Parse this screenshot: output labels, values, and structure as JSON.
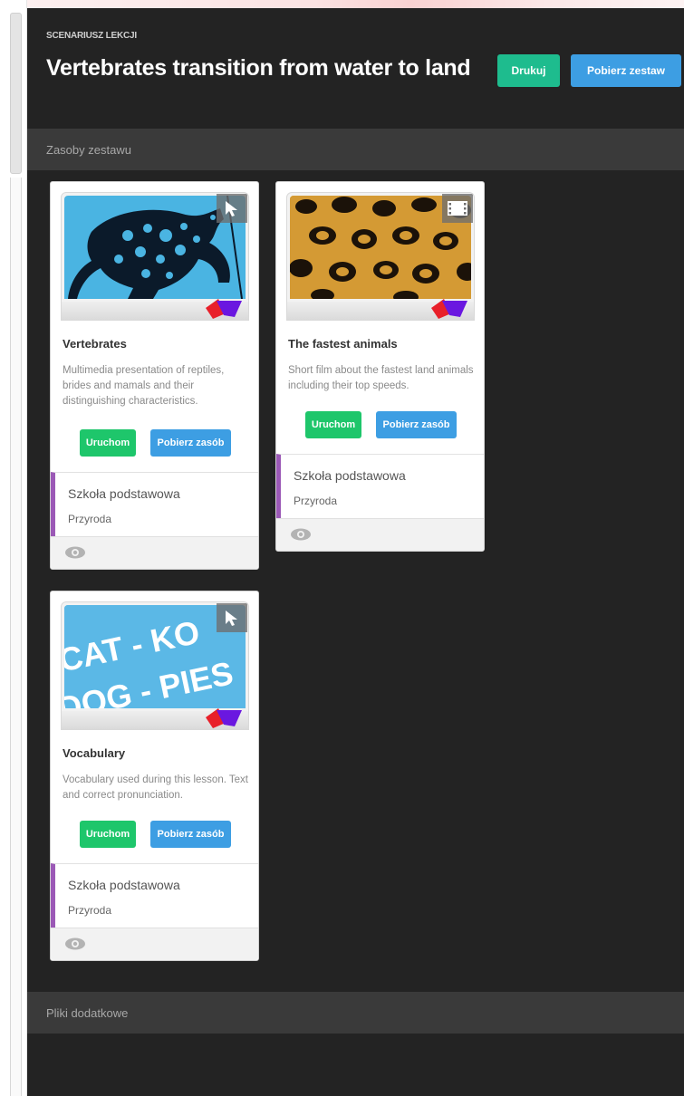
{
  "header": {
    "eyebrow": "SCENARIUSZ LEKCJI",
    "title": "Vertebrates transition from water to land",
    "print_label": "Drukuj",
    "download_set_label": "Pobierz zestaw"
  },
  "sections": {
    "resources": "Zasoby zestawu",
    "extra_files": "Pliki dodatkowe"
  },
  "cards": [
    {
      "title": "Vertebrates",
      "description": "Multimedia presentation of reptiles, brides and mamals and their distinguishing characteristics.",
      "run_label": "Uruchom",
      "download_label": "Pobierz zasób",
      "level": "Szkoła podstawowa",
      "subject": "Przyroda",
      "type_icon": "cursor-icon",
      "thumbnail": "frog-silhouette"
    },
    {
      "title": "The fastest animals",
      "description": "Short film about the fastest land animals including their top speeds.",
      "run_label": "Uruchom",
      "download_label": "Pobierz zasób",
      "level": "Szkoła podstawowa",
      "subject": "Przyroda",
      "type_icon": "film-icon",
      "thumbnail": "leopard-fur"
    },
    {
      "title": "Vocabulary",
      "description": "Vocabulary used during this lesson. Text and correct pronunciation.",
      "run_label": "Uruchom",
      "download_label": "Pobierz zasób",
      "level": "Szkoła podstawowa",
      "subject": "Przyroda",
      "type_icon": "cursor-icon",
      "thumbnail": "words-cat-dog",
      "thumb_text": [
        "CAT - KO",
        "DOG - PIES"
      ]
    }
  ],
  "colors": {
    "panel": "#232323",
    "print_button": "#1ebc8e",
    "blue_button": "#3d9ee3",
    "run_button": "#1ec66b",
    "meta_accent": "#9b59b6"
  }
}
